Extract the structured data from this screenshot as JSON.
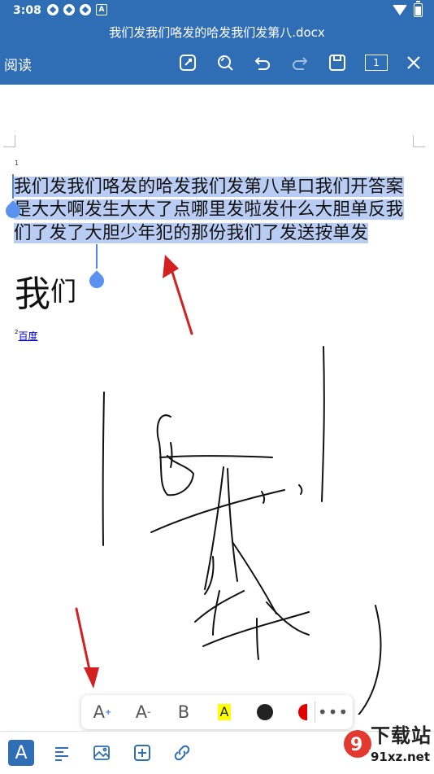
{
  "status_bar": {
    "time": "3:08",
    "notification_icons": [
      "sync-icon",
      "sync-icon",
      "sync-icon",
      "a-badge-icon"
    ],
    "right_icons": [
      "wifi-icon",
      "battery-icon"
    ],
    "a_badge": "A"
  },
  "header": {
    "title": "我们发我们咯发的哈发我们发第八.docx",
    "mode_label": "阅读",
    "page_count": "1",
    "actions": [
      "edit-icon",
      "search-icon",
      "undo-icon",
      "redo-icon",
      "save-icon",
      "page-count-icon",
      "close-icon"
    ]
  },
  "document": {
    "footnote_ref_1": "1",
    "selected_paragraph": "我们发我们咯发的哈发我们发第八单口我们开答案是大大啊发生大大了点哪里发啦发什么大胆单反我们了发了大胆少年犯的那份我们了发送按单发",
    "big_word": "我",
    "big_word_sup": "们",
    "footnote_num": "2",
    "footnote_link": "百度"
  },
  "format_bar": {
    "increase_font_label": "A",
    "increase_font_mark": "+",
    "decrease_font_label": "A",
    "decrease_font_mark": "-",
    "bold_label": "B",
    "highlight_label": "A",
    "more_label": "•••"
  },
  "bottom_toolbar": {
    "font_label": "A",
    "items": [
      "text-format-icon",
      "paragraph-icon",
      "image-icon",
      "insert-icon",
      "link-icon"
    ]
  },
  "watermark": {
    "title": "下载站",
    "url": "91xz.net"
  },
  "colors": {
    "appbar": "#2f6db5",
    "selection": "#b9ccf3",
    "cursor": "#4f86e6",
    "highlight": "#ffff00",
    "arrow": "#d32020"
  }
}
